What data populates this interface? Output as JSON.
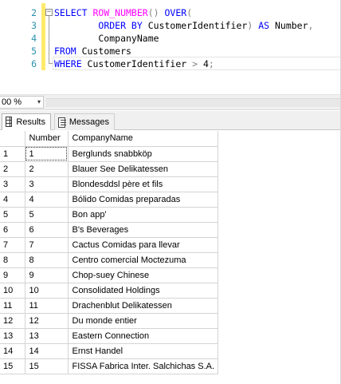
{
  "editor": {
    "lines": [
      {
        "number": "2",
        "segments": [
          [
            "kw",
            "SELECT "
          ],
          [
            "fn",
            "ROW_NUMBER"
          ],
          [
            "op",
            "() "
          ],
          [
            "kw",
            "OVER"
          ],
          [
            "op",
            "("
          ]
        ]
      },
      {
        "number": "3",
        "segments": [
          [
            "id",
            "        "
          ],
          [
            "kw",
            "ORDER BY "
          ],
          [
            "id",
            "CustomerIdentifier"
          ],
          [
            "op",
            ") "
          ],
          [
            "kw",
            "AS "
          ],
          [
            "id",
            "Number"
          ],
          [
            "op",
            ","
          ]
        ]
      },
      {
        "number": "4",
        "segments": [
          [
            "id",
            "        CompanyName"
          ]
        ]
      },
      {
        "number": "5",
        "segments": [
          [
            "kw",
            "FROM "
          ],
          [
            "id",
            "Customers"
          ]
        ]
      },
      {
        "number": "6",
        "segments": [
          [
            "kw",
            "WHERE "
          ],
          [
            "id",
            "CustomerIdentifier "
          ],
          [
            "op",
            "> "
          ],
          [
            "id",
            "4"
          ],
          [
            "op",
            ";"
          ]
        ]
      }
    ],
    "fold_symbol": "−"
  },
  "zoom": {
    "value": "00 %",
    "arrow": "▾"
  },
  "tabs": [
    {
      "label": "Results",
      "icon": "grid-icon",
      "active": true
    },
    {
      "label": "Messages",
      "icon": "messages-icon",
      "active": false
    }
  ],
  "results": {
    "columns": [
      "Number",
      "CompanyName"
    ],
    "rows": [
      [
        "1",
        "1",
        "Berglunds snabbköp"
      ],
      [
        "2",
        "2",
        "Blauer See Delikatessen"
      ],
      [
        "3",
        "3",
        "Blondesddsl père et fils"
      ],
      [
        "4",
        "4",
        "Bólido Comidas preparadas"
      ],
      [
        "5",
        "5",
        "Bon app'"
      ],
      [
        "6",
        "6",
        "B's Beverages"
      ],
      [
        "7",
        "7",
        "Cactus Comidas para llevar"
      ],
      [
        "8",
        "8",
        "Centro comercial Moctezuma"
      ],
      [
        "9",
        "9",
        "Chop-suey Chinese"
      ],
      [
        "10",
        "10",
        "Consolidated Holdings"
      ],
      [
        "11",
        "11",
        "Drachenblut Delikatessen"
      ],
      [
        "12",
        "12",
        "Du monde entier"
      ],
      [
        "13",
        "13",
        "Eastern Connection"
      ],
      [
        "14",
        "14",
        "Ernst Handel"
      ],
      [
        "15",
        "15",
        "FISSA Fabrica Inter. Salchichas S.A."
      ]
    ]
  },
  "colors": {
    "keyword": "#0000ff",
    "function": "#ff00ff",
    "operator": "#808080",
    "line_number": "#2b91af",
    "change_bar": "#ffe96b"
  }
}
